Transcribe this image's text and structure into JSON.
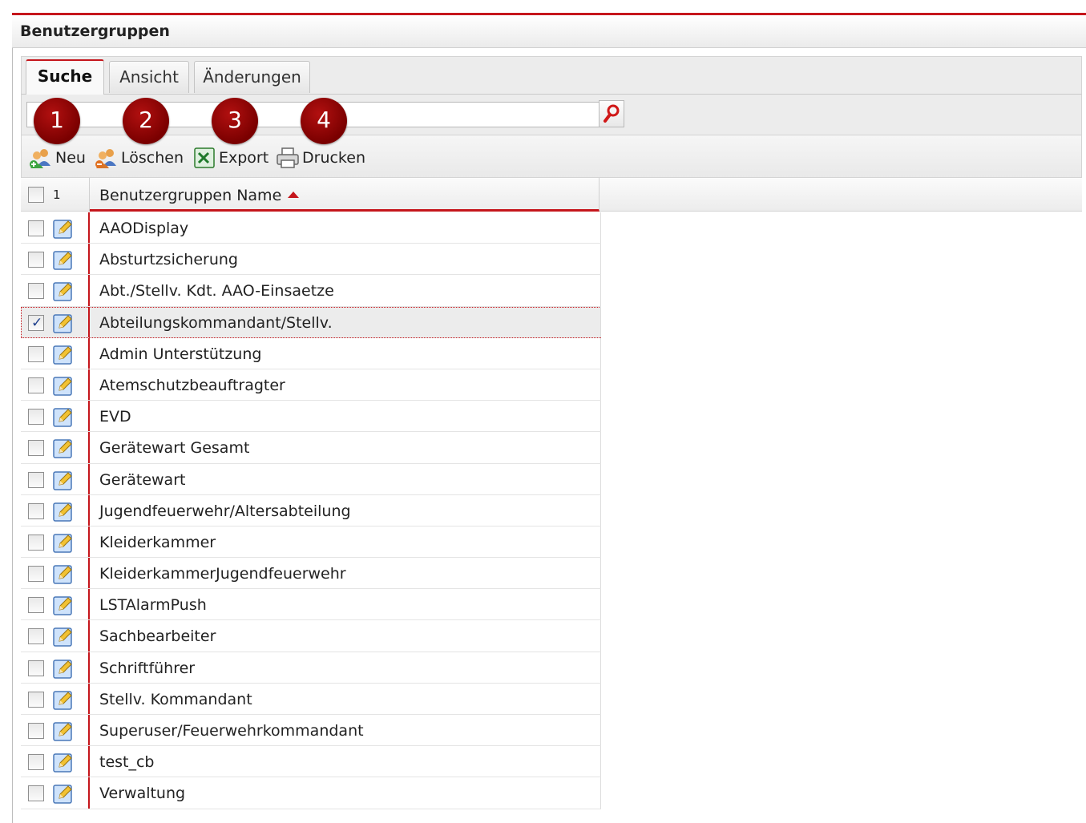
{
  "window": {
    "title": "Benutzergruppen"
  },
  "tabs": [
    {
      "label": "Suche",
      "active": true
    },
    {
      "label": "Ansicht",
      "active": false
    },
    {
      "label": "Änderungen",
      "active": false
    }
  ],
  "search": {
    "value": "",
    "placeholder": "",
    "button_icon": "search-icon"
  },
  "callouts": [
    "1",
    "2",
    "3",
    "4"
  ],
  "toolbar": {
    "new_label": "Neu",
    "delete_label": "Löschen",
    "export_label": "Export",
    "print_label": "Drucken"
  },
  "grid": {
    "selected_count": "1",
    "column_header": "Benutzergruppen Name",
    "sort": "ascending",
    "rows": [
      {
        "name": "AAODisplay",
        "checked": false
      },
      {
        "name": "Absturtzsicherung",
        "checked": false
      },
      {
        "name": "Abt./Stellv. Kdt. AAO-Einsaetze",
        "checked": false
      },
      {
        "name": "Abteilungskommandant/Stellv.",
        "checked": true
      },
      {
        "name": "Admin Unterstützung",
        "checked": false
      },
      {
        "name": "Atemschutzbeauftragter",
        "checked": false
      },
      {
        "name": "EVD",
        "checked": false
      },
      {
        "name": "Gerätewart Gesamt",
        "checked": false
      },
      {
        "name": "Gerätewart",
        "checked": false
      },
      {
        "name": "Jugendfeuerwehr/Altersabteilung",
        "checked": false
      },
      {
        "name": "Kleiderkammer",
        "checked": false
      },
      {
        "name": "KleiderkammerJugendfeuerwehr",
        "checked": false
      },
      {
        "name": "LSTAlarmPush",
        "checked": false
      },
      {
        "name": "Sachbearbeiter",
        "checked": false
      },
      {
        "name": "Schriftführer",
        "checked": false
      },
      {
        "name": "Stellv. Kommandant",
        "checked": false
      },
      {
        "name": "Superuser/Feuerwehrkommandant",
        "checked": false
      },
      {
        "name": "test_cb",
        "checked": false
      },
      {
        "name": "Verwaltung",
        "checked": false
      }
    ]
  },
  "colors": {
    "accent": "#c5161c",
    "badge": "#8b0000"
  }
}
